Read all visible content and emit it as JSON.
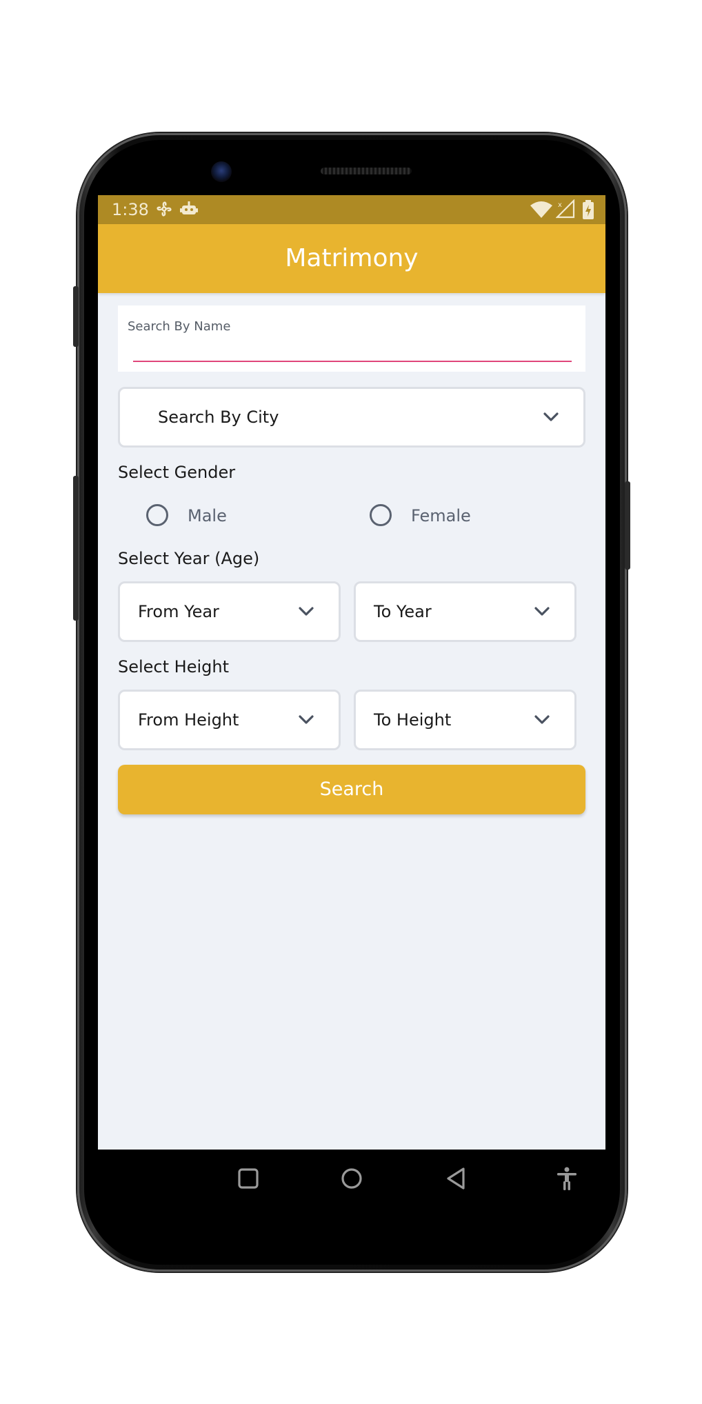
{
  "status_bar": {
    "time": "1:38",
    "icons": [
      "fan-icon",
      "android-robot-icon",
      "wifi-icon",
      "signal-icon",
      "battery-icon"
    ]
  },
  "app_bar": {
    "title": "Matrimony"
  },
  "search_name": {
    "label": "Search By Name",
    "value": ""
  },
  "city_dropdown": {
    "label": "Search By City"
  },
  "gender": {
    "title": "Select Gender",
    "options": [
      "Male",
      "Female"
    ]
  },
  "year": {
    "title": "Select Year (Age)",
    "from_label": "From Year",
    "to_label": "To Year"
  },
  "height": {
    "title": "Select Height",
    "from_label": "From Height",
    "to_label": "To Height"
  },
  "search_button": {
    "label": "Search"
  },
  "nav_bar": {
    "buttons": [
      "recents-icon",
      "home-icon",
      "back-icon",
      "accessibility-icon"
    ]
  },
  "colors": {
    "accent": "#e8b42f",
    "status_bar": "#ae8a24",
    "background": "#eff2f7",
    "input_underline": "#e0457a"
  }
}
